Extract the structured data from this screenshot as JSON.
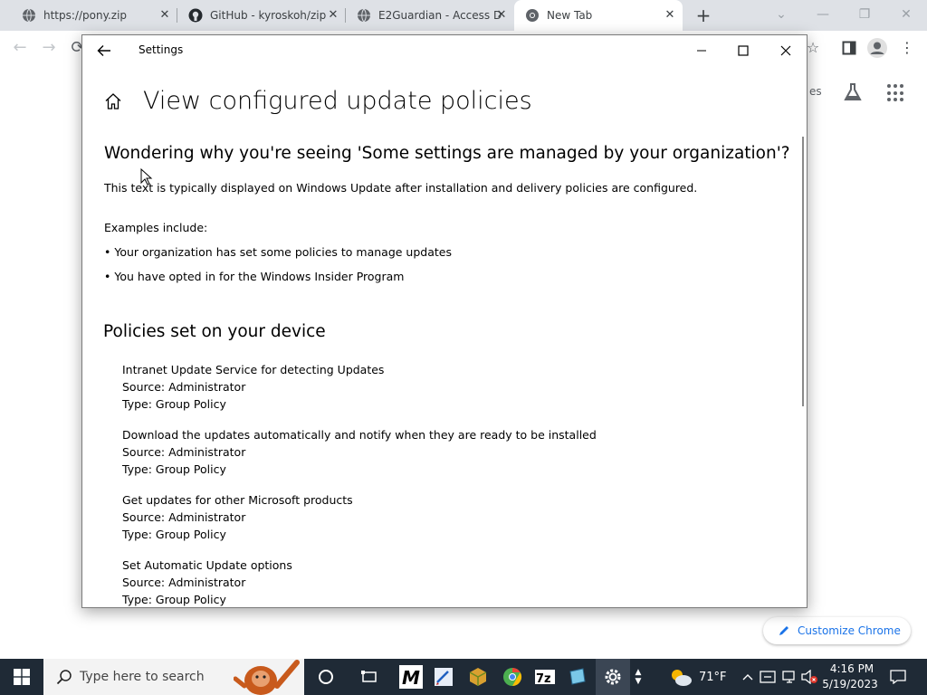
{
  "browser": {
    "tabs": [
      {
        "label": "https://pony.zip",
        "favicon": "globe-icon"
      },
      {
        "label": "GitHub - kyroskoh/zip",
        "favicon": "github-icon"
      },
      {
        "label": "E2Guardian - Access D",
        "favicon": "globe-icon"
      },
      {
        "label": "New Tab",
        "favicon": "chrome-icon",
        "active": true
      }
    ],
    "new_tab_symbol": "+",
    "partial_text": "es",
    "customize_label": "Customize Chrome"
  },
  "settings": {
    "window_title": "Settings",
    "page_title": "View configured update policies",
    "why_heading": "Wondering why you're seeing 'Some settings are managed by your organization'?",
    "why_text": "This text is typically displayed on Windows Update after installation and delivery policies are configured.",
    "examples_label": "Examples include:",
    "examples": [
      "• Your organization has set some policies to manage updates",
      "• You have opted in for the Windows Insider Program"
    ],
    "policies_heading": "Policies set on your device",
    "policies": [
      {
        "name": "Intranet Update Service for detecting Updates",
        "source": "Source: Administrator",
        "type": "Type: Group Policy"
      },
      {
        "name": "Download the updates automatically and notify when they are ready to be installed",
        "source": "Source: Administrator",
        "type": "Type: Group Policy"
      },
      {
        "name": "Get updates for other Microsoft products",
        "source": "Source: Administrator",
        "type": "Type: Group Policy"
      },
      {
        "name": "Set Automatic Update options",
        "source": "Source: Administrator",
        "type": "Type: Group Policy"
      }
    ]
  },
  "taskbar": {
    "search_placeholder": "Type here to search",
    "weather": "71°F",
    "time": "4:16 PM",
    "date": "5/19/2023"
  },
  "colors": {
    "taskbar_bg": "#1f2a36",
    "accent_blue": "#1a73e8",
    "tabstrip_bg": "#dee1e6"
  }
}
